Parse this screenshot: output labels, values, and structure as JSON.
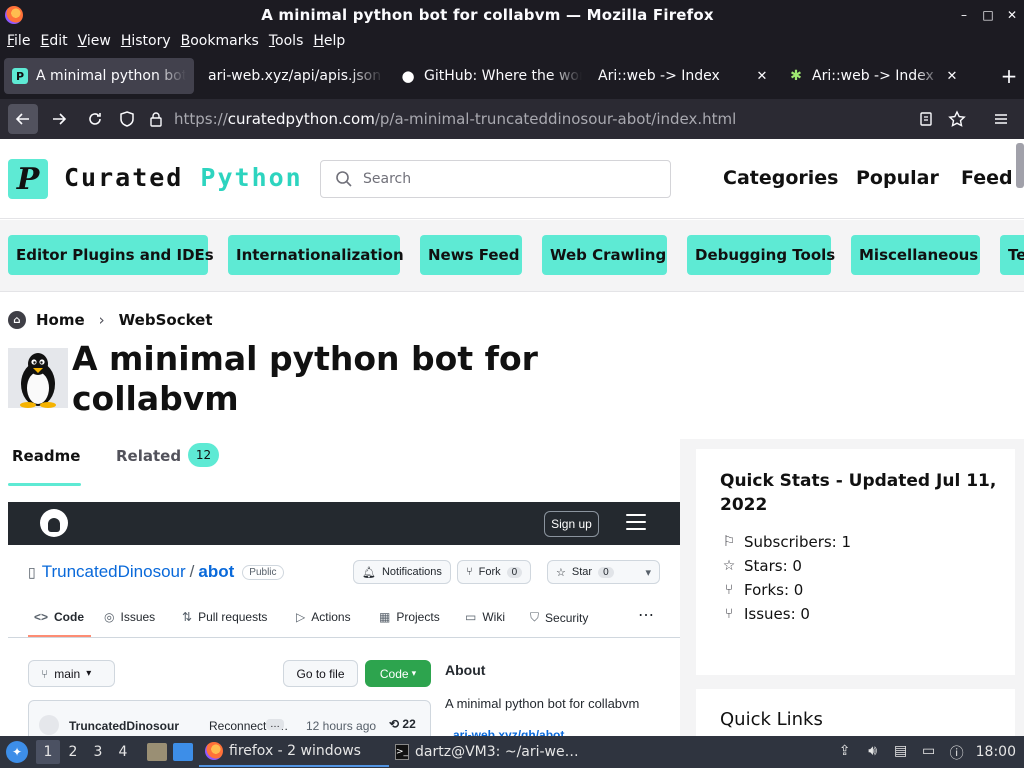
{
  "window": {
    "title": "A minimal python bot for collabvm — Mozilla Firefox",
    "controls": [
      "–",
      "□",
      "✕"
    ]
  },
  "menu": [
    "File",
    "Edit",
    "View",
    "History",
    "Bookmarks",
    "Tools",
    "Help"
  ],
  "tabs": [
    {
      "label": "A minimal python bot for collabvm",
      "favicon": "P",
      "favicon_color": "#5eead4",
      "active": true
    },
    {
      "label": "ari-web.xyz/api/apis.json",
      "favicon": "",
      "favicon_color": "",
      "active": false
    },
    {
      "label": "GitHub: Where the world builds software",
      "favicon": "●",
      "favicon_color": "#ffffff",
      "active": false
    },
    {
      "label": "Ari::web -> Index",
      "favicon": "",
      "favicon_color": "",
      "active": false
    },
    {
      "label": "Ari::web -> Index",
      "favicon": "✱",
      "favicon_color": "#9fe870",
      "active": false
    }
  ],
  "newtab_label": "+",
  "url": {
    "prefix": "https://",
    "host": "curatedpython.com",
    "path": "/p/a-minimal-truncateddinosour-abot/index.html"
  },
  "site": {
    "logo_letter": "P",
    "logo_word1": "Curated",
    "logo_word2": "Python",
    "search_placeholder": "Search",
    "nav": [
      "Categories",
      "Popular",
      "Feed"
    ],
    "categories": [
      "Editor Plugins and IDEs",
      "Internationalization",
      "News Feed",
      "Web Crawling",
      "Debugging Tools",
      "Miscellaneous",
      "Te"
    ]
  },
  "breadcrumb": {
    "home": "Home",
    "current": "WebSocket"
  },
  "page_title": "A minimal python bot for collabvm",
  "content_tabs": {
    "readme": "Readme",
    "related": "Related",
    "related_count": "12"
  },
  "github": {
    "signup": "Sign up",
    "owner": "TruncatedDinosour",
    "repo": "abot",
    "visibility": "Public",
    "notifications": "Notifications",
    "fork": "Fork",
    "fork_count": "0",
    "star": "Star",
    "star_count": "0",
    "nav": [
      "Code",
      "Issues",
      "Pull requests",
      "Actions",
      "Projects",
      "Wiki",
      "Security"
    ],
    "branch": "main",
    "go_to_file": "Go to file",
    "code_button": "Code",
    "about_heading": "About",
    "about_desc": "A minimal python bot for collabvm",
    "about_link": "ari-web.xyz/gh/abot",
    "commit_user": "TruncatedDinosour",
    "commit_msg": "Reconnect a…",
    "commit_time": "12 hours ago",
    "commit_count": "22"
  },
  "stats": {
    "title": "Quick Stats - Updated Jul 11, 2022",
    "items": [
      "Subscribers: 1",
      "Stars: 0",
      "Forks: 0",
      "Issues: 0"
    ]
  },
  "quick_links_title": "Quick Links",
  "taskbar": {
    "workspaces": [
      "1",
      "2",
      "3",
      "4"
    ],
    "tasks": [
      "firefox - 2 windows",
      "dartz@VM3: ~/ari-we…"
    ],
    "clock": "18:00"
  }
}
